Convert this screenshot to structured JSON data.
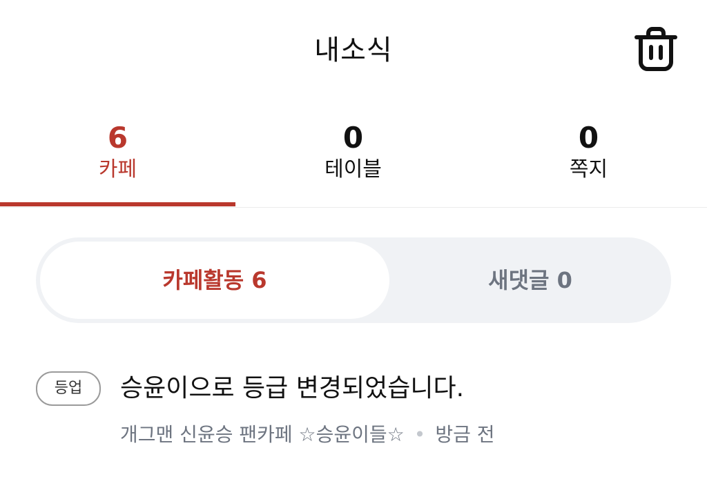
{
  "header": {
    "title": "내소식",
    "trash_icon": "trash-icon"
  },
  "tabs": [
    {
      "count": "6",
      "label": "카페",
      "active": true
    },
    {
      "count": "0",
      "label": "테이블",
      "active": false
    },
    {
      "count": "0",
      "label": "쪽지",
      "active": false
    }
  ],
  "segmented": {
    "active_label": "카페활동 6",
    "inactive_label": "새댓글 0"
  },
  "notices": [
    {
      "badge": "등업",
      "title": "승윤이으로 등급 변경되었습니다.",
      "cafe": "개그맨 신윤승 팬카페 ☆승윤이들☆",
      "time": "방금 전"
    }
  ],
  "colors": {
    "accent": "#b9382d",
    "muted_text": "#6d7480",
    "segment_bg": "#f0f2f5"
  }
}
